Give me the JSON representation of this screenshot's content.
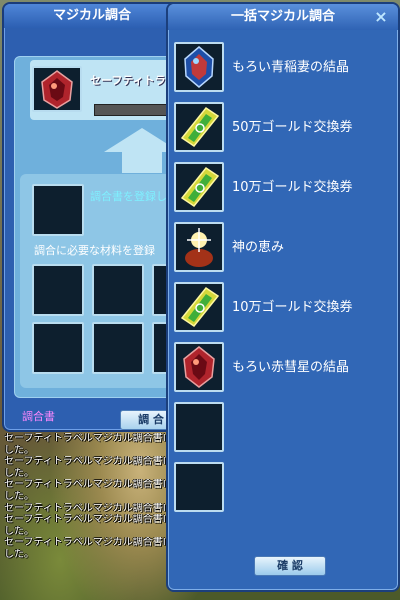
{
  "left_window": {
    "title": "マジカル調合",
    "item_name": "セーフティトラベル",
    "register_hint": "調合書を登録し",
    "materials_hint": "調合に必要な材料を登録",
    "recipe_label": "調合書",
    "button_label": "調 合"
  },
  "right_window": {
    "title": "一括マジカル調合",
    "close_label": "×",
    "confirm_label": "確 認",
    "items": [
      {
        "name": "もろい青稲妻の結晶",
        "icon": "blue-crystal-icon"
      },
      {
        "name": "50万ゴールド交換券",
        "icon": "gold-ticket-icon"
      },
      {
        "name": "10万ゴールド交換券",
        "icon": "gold-ticket-icon"
      },
      {
        "name": "神の恵み",
        "icon": "divine-blessing-icon"
      },
      {
        "name": "10万ゴールド交換券",
        "icon": "gold-ticket-icon"
      },
      {
        "name": "もろい赤彗星の結晶",
        "icon": "red-crystal-icon"
      }
    ]
  },
  "chat": {
    "lines": [
      "セーフティトラベルマジカル調合書IIで",
      "した。",
      "セーフティトラベルマジカル調合書IIで",
      "した。",
      "セーフティトラベルマジカル調合書IIで",
      "した。",
      "セーフティトラベルマジカル調合書IIで",
      "セーフティトラベルマジカル調合書IIで",
      "した。",
      "セーフティトラベルマジカル調合書IIで",
      "した。"
    ]
  }
}
